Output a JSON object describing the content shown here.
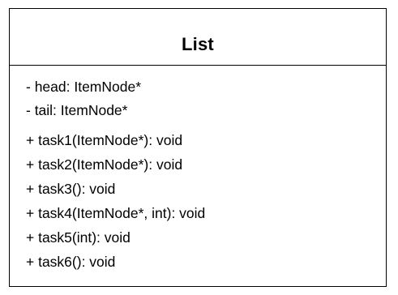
{
  "class_name": "List",
  "attributes": [
    "- head: ItemNode*",
    "- tail: ItemNode*"
  ],
  "methods": [
    "+ task1(ItemNode*): void",
    "+ task2(ItemNode*): void",
    "+ task3(): void",
    "+ task4(ItemNode*, int): void",
    "+ task5(int): void",
    "+ task6(): void"
  ]
}
